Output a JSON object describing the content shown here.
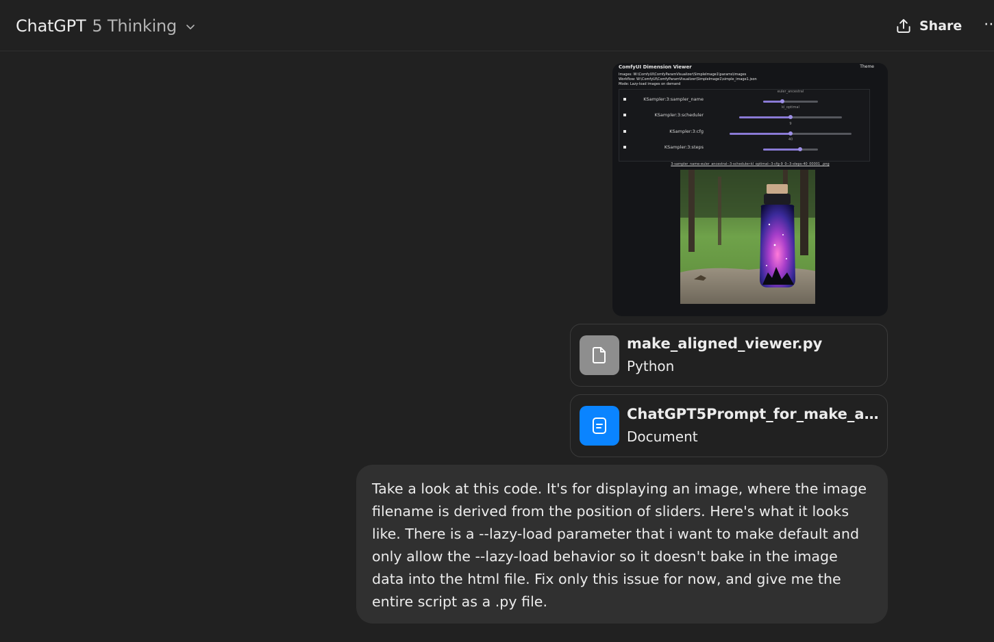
{
  "header": {
    "model_name": "ChatGPT",
    "model_version": "5 Thinking",
    "share_label": "Share",
    "more_label": "⋯"
  },
  "attached_screenshot": {
    "title": "ComfyUI Dimension Viewer",
    "theme_label": "Theme",
    "meta": [
      "Images: W:\\ComfyUI\\ComfyParamVisualizer\\SimpleImage1\\params\\images",
      "Workflow: W:\\ComfyUI\\ComfyParamVisualizer\\SimpleImage1\\simple_image1.json",
      "Mode: Lazy-load images on demand"
    ],
    "params": [
      {
        "label": "KSampler:3:sampler_name",
        "value": "euler_ancestral",
        "position": 0.35
      },
      {
        "label": "KSampler:3:scheduler",
        "value": "kl_optimal",
        "position": 0.5
      },
      {
        "label": "KSampler:3:cfg",
        "value": "9",
        "position": 0.5
      },
      {
        "label": "KSampler:3:steps",
        "value": "40",
        "position": 0.67
      }
    ],
    "filename": "3-sampler_name-euler_ancestral--3-scheduler-kl_optimal--3-cfg-9_0--3-steps-40_00001_.png"
  },
  "attachments": [
    {
      "name": "make_aligned_viewer.py",
      "type": "Python",
      "icon": "file-icon",
      "icon_color": "#8e8e8e"
    },
    {
      "name": "ChatGPT5Prompt_for_make_aligned_viewer",
      "type": "Document",
      "icon": "document-icon",
      "icon_color": "#0a84ff"
    }
  ],
  "message": {
    "text": "Take a look at this code. It's for displaying an image, where the image filename is derived from the position of sliders. Here's what it looks like. There is a --lazy-load parameter that i want to make default and only allow the --lazy-load behavior so it doesn't bake in the image data into the html file. Fix only this issue for now, and give me the entire script as a .py file."
  },
  "colors": {
    "background": "#212121",
    "bubble": "#303030",
    "accent_blue": "#0a84ff",
    "slider": "#8a7ad6"
  }
}
